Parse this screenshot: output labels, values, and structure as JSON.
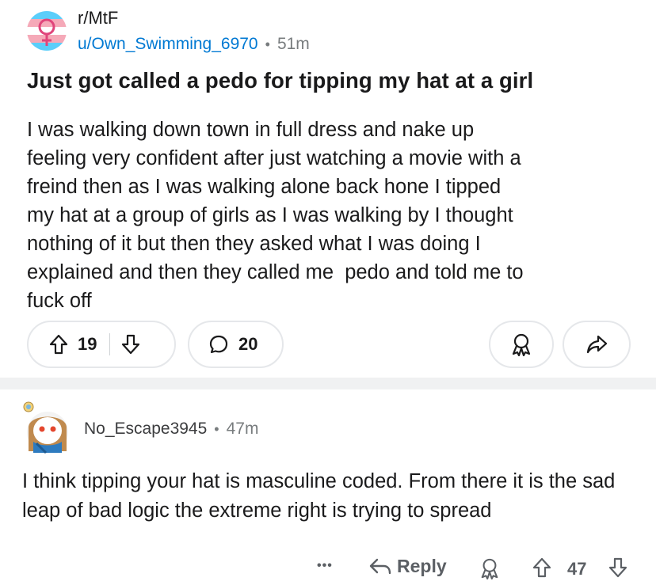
{
  "post": {
    "subreddit": "r/MtF",
    "author": "u/Own_Swimming_6970",
    "separator": "•",
    "time": "51m",
    "title": "Just got called a pedo for tipping my hat at a girl",
    "body": "I was walking down town in full dress and nake up\nfeeling very confident after just watching a movie with a\nfreind then as I was walking alone back hone I tipped\nmy hat at a group of girls as I was walking by I thought\nnothing of it but then they asked what I was doing I\nexplained and then they called me  pedo and told me to\nfuck off",
    "upvotes": "19",
    "comments": "20",
    "icons": {
      "subreddit": "trans-flag-female-symbol-icon",
      "upvote": "arrow-up-icon",
      "downvote": "arrow-down-icon",
      "comment": "speech-bubble-icon",
      "award": "award-ribbon-icon",
      "share": "share-arrow-icon"
    }
  },
  "comment": {
    "author": "No_Escape3945",
    "separator": "•",
    "time": "47m",
    "text": "I think tipping your hat is masculine coded. From there it is the sad leap of bad logic the extreme right is trying to spread",
    "more": "•••",
    "reply_label": "Reply",
    "votes": "47"
  },
  "colors": {
    "link_blue": "#0079d3",
    "text": "#1a1a1b",
    "muted": "#787c7e",
    "pill_border": "#e5e7ea",
    "band": "#f0f1f2",
    "trans_blue": "#5bcefa",
    "trans_pink": "#f5a9b8"
  }
}
